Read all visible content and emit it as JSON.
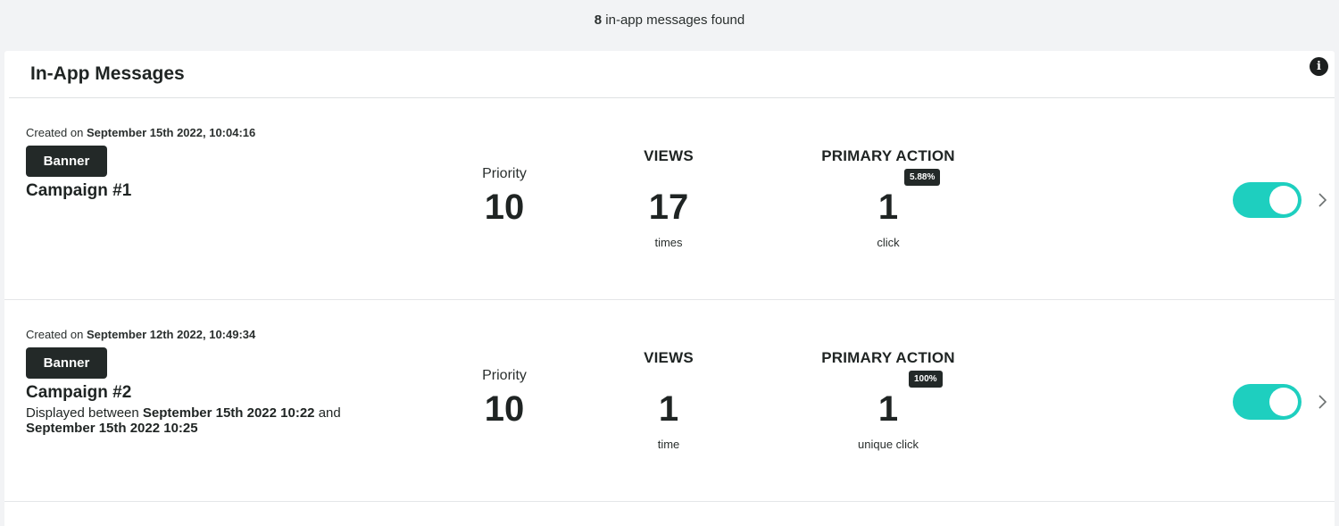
{
  "summary": {
    "count": "8",
    "text": " in-app messages found"
  },
  "panel": {
    "title": "In-App Messages",
    "info_icon": "info-icon"
  },
  "messages": [
    {
      "created_prefix": "Created on ",
      "created_date": "September 15th 2022, 10:04:16",
      "type": "Banner",
      "name": "Campaign #1",
      "display_prefix": "",
      "display_start": "",
      "display_mid": "",
      "display_end": "",
      "priority_label": "Priority",
      "priority": "10",
      "views_label": "VIEWS",
      "views": "17",
      "views_unit": "times",
      "action_label": "PRIMARY ACTION",
      "action_rate": "5.88%",
      "action_count": "1",
      "action_unit": "click",
      "enabled": true
    },
    {
      "created_prefix": "Created on ",
      "created_date": "September 12th 2022, 10:49:34",
      "type": "Banner",
      "name": "Campaign #2",
      "display_prefix": "Displayed between ",
      "display_start": "September 15th 2022 10:22",
      "display_mid": " and ",
      "display_end": "September 15th 2022 10:25",
      "priority_label": "Priority",
      "priority": "10",
      "views_label": "VIEWS",
      "views": "1",
      "views_unit": "time",
      "action_label": "PRIMARY ACTION",
      "action_rate": "100%",
      "action_count": "1",
      "action_unit": "unique click",
      "enabled": true
    }
  ],
  "colors": {
    "toggle_on": "#1ecfbf",
    "badge_bg": "#232928",
    "background": "#f2f3f5"
  }
}
